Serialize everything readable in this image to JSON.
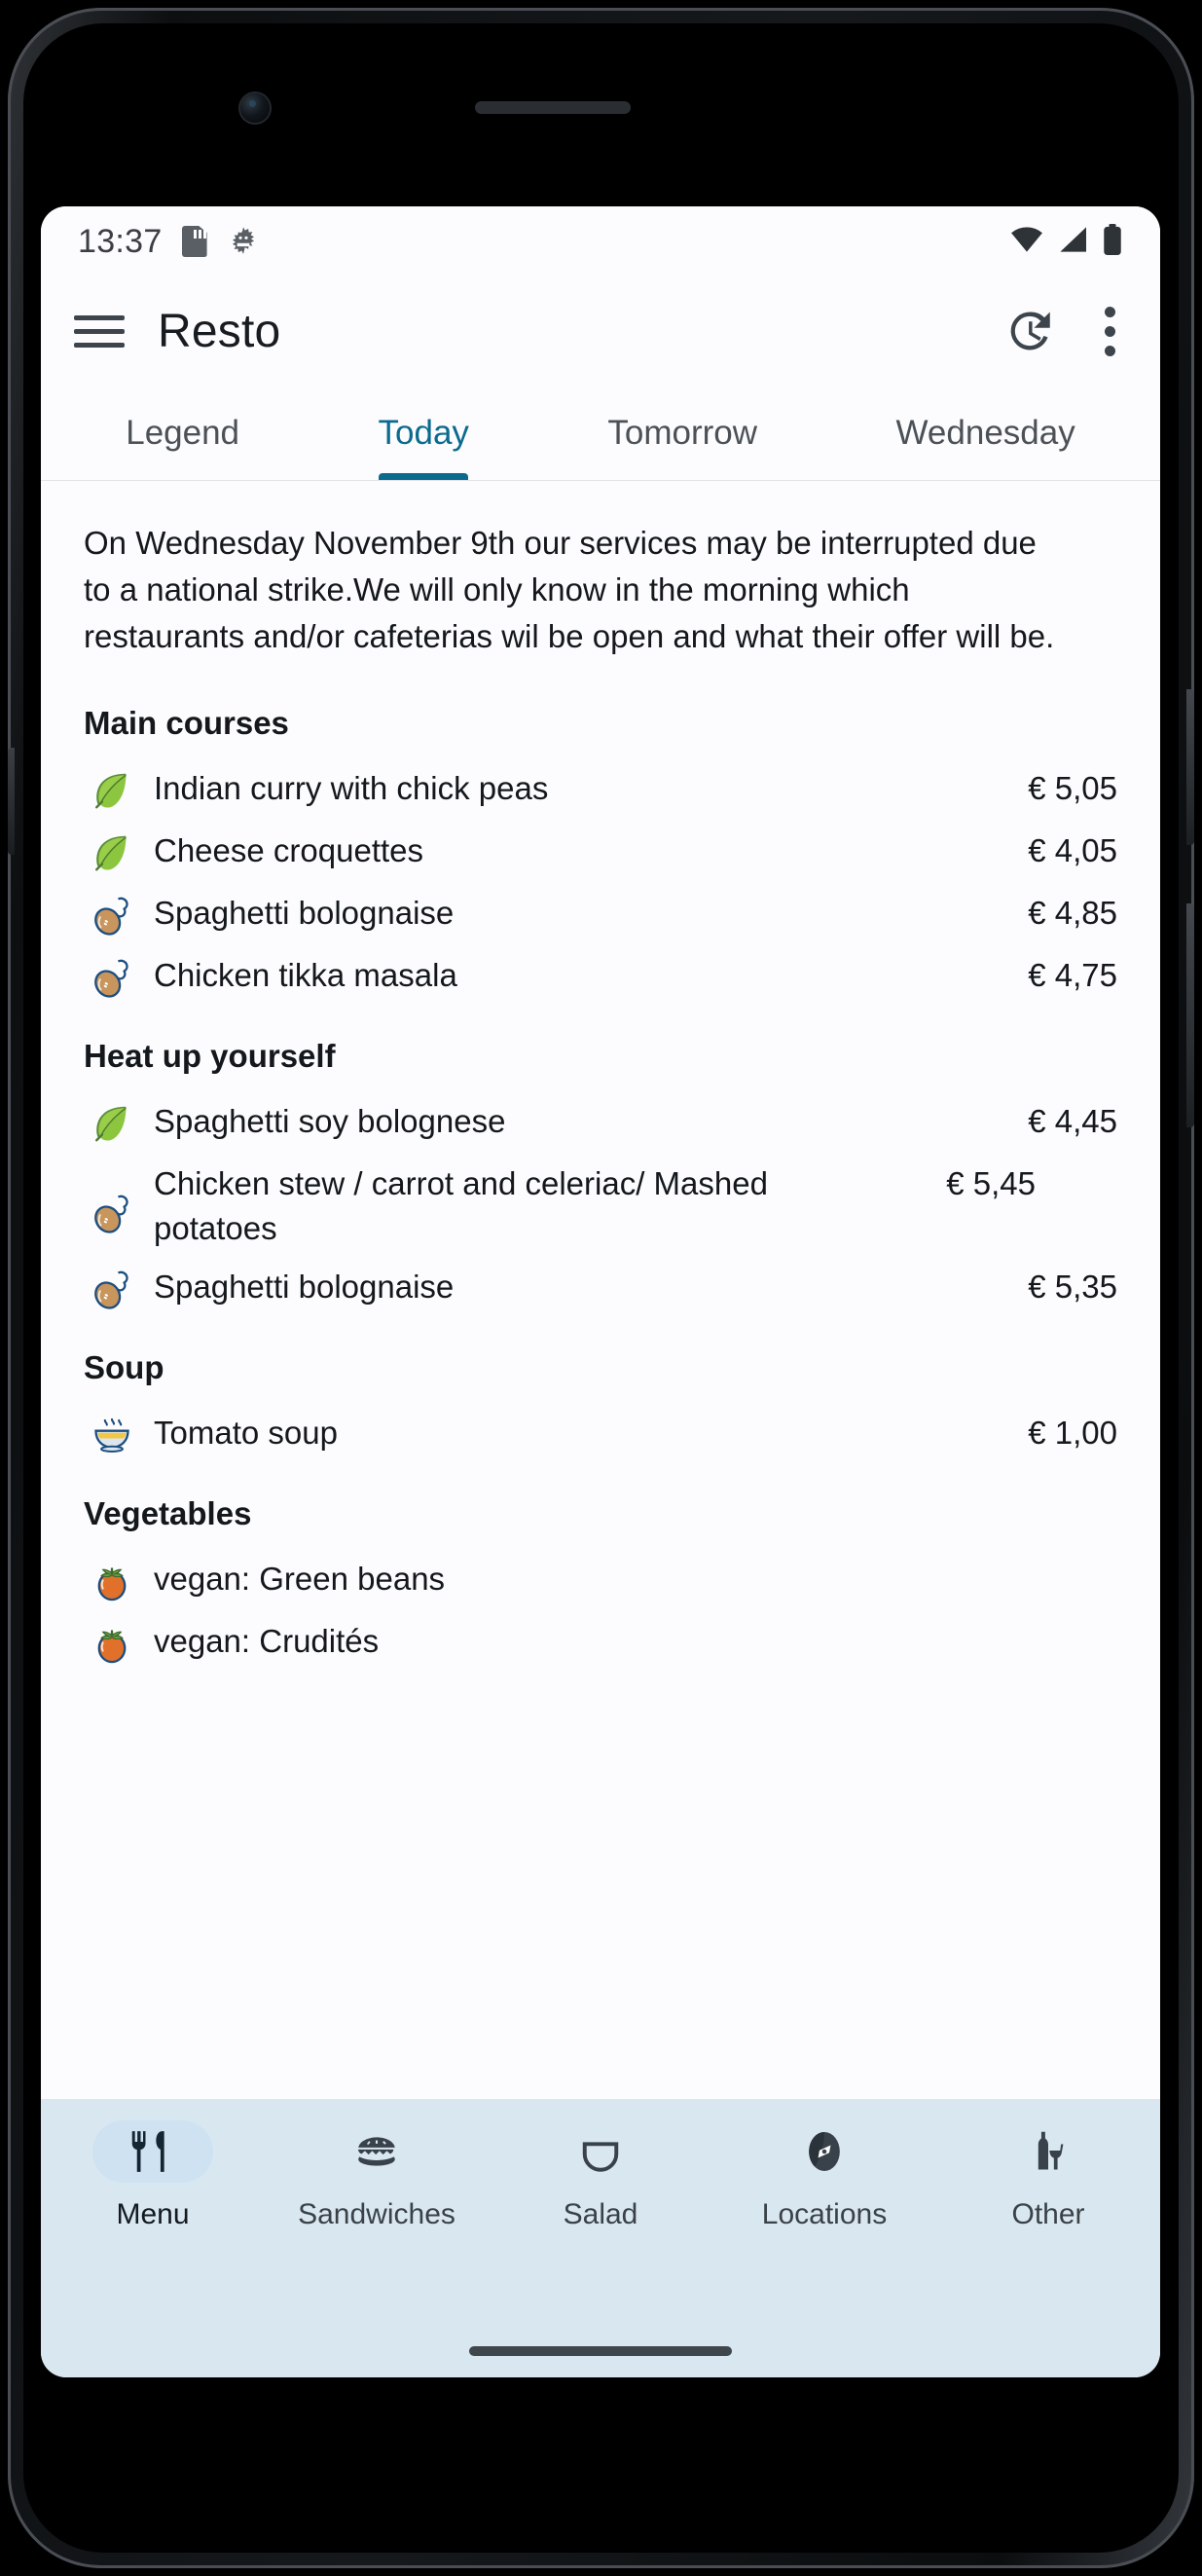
{
  "status_bar": {
    "time": "13:37",
    "icons_left": [
      "sd-card-icon",
      "android-bug-icon"
    ],
    "icons_right": [
      "wifi-icon",
      "cellular-signal-icon",
      "battery-icon"
    ]
  },
  "app_bar": {
    "menu_icon": "hamburger-menu-icon",
    "title": "Resto",
    "history_icon": "history-icon",
    "overflow_icon": "more-vertical-icon"
  },
  "tabs": [
    {
      "label": "Legend",
      "active": false
    },
    {
      "label": "Today",
      "active": true
    },
    {
      "label": "Tomorrow",
      "active": false
    },
    {
      "label": "Wednesday",
      "active": false
    }
  ],
  "notice": "On Wednesday November 9th our services may be interrupted due to a national strike.We will only know in the morning which restaurants and/or cafeterias wil be open and what their offer will be.",
  "sections": [
    {
      "title": "Main courses",
      "items": [
        {
          "icon": "leaf-icon",
          "name": "Indian curry with chick peas",
          "price": "€ 5,05"
        },
        {
          "icon": "leaf-icon",
          "name": "Cheese croquettes",
          "price": "€ 4,05"
        },
        {
          "icon": "drumstick-icon",
          "name": "Spaghetti bolognaise",
          "price": "€ 4,85"
        },
        {
          "icon": "drumstick-icon",
          "name": "Chicken tikka masala",
          "price": "€ 4,75"
        }
      ]
    },
    {
      "title": "Heat up yourself",
      "items": [
        {
          "icon": "leaf-icon",
          "name": "Spaghetti soy bolognese",
          "price": "€ 4,45"
        },
        {
          "icon": "drumstick-icon",
          "name": "Chicken stew / carrot and celeriac/ Mashed potatoes",
          "price": "€ 5,45"
        },
        {
          "icon": "drumstick-icon",
          "name": "Spaghetti bolognaise",
          "price": "€ 5,35"
        }
      ]
    },
    {
      "title": "Soup",
      "items": [
        {
          "icon": "soup-bowl-icon",
          "name": "Tomato soup",
          "price": "€ 1,00"
        }
      ]
    },
    {
      "title": "Vegetables",
      "items": [
        {
          "icon": "tomato-icon",
          "name": "vegan: Green beans",
          "price": ""
        },
        {
          "icon": "tomato-icon",
          "name": "vegan: Crudités",
          "price": ""
        }
      ]
    }
  ],
  "bottom_nav": [
    {
      "label": "Menu",
      "icon": "fork-knife-icon",
      "active": true
    },
    {
      "label": "Sandwiches",
      "icon": "sandwich-icon",
      "active": false
    },
    {
      "label": "Salad",
      "icon": "salad-bowl-icon",
      "active": false
    },
    {
      "label": "Locations",
      "icon": "compass-icon",
      "active": false
    },
    {
      "label": "Other",
      "icon": "bottle-cup-icon",
      "active": false
    }
  ],
  "colors": {
    "accent": "#0B6B8F",
    "text_primary": "#14181c",
    "text_secondary": "#4c5157",
    "nav_background": "#D9E7F0",
    "nav_active_pill": "#CFE2F2",
    "screen_background": "#FCFCFE",
    "leaf_green": "#8CC63F",
    "meat_tan": "#C8955C",
    "tomato_orange": "#E1702A"
  }
}
